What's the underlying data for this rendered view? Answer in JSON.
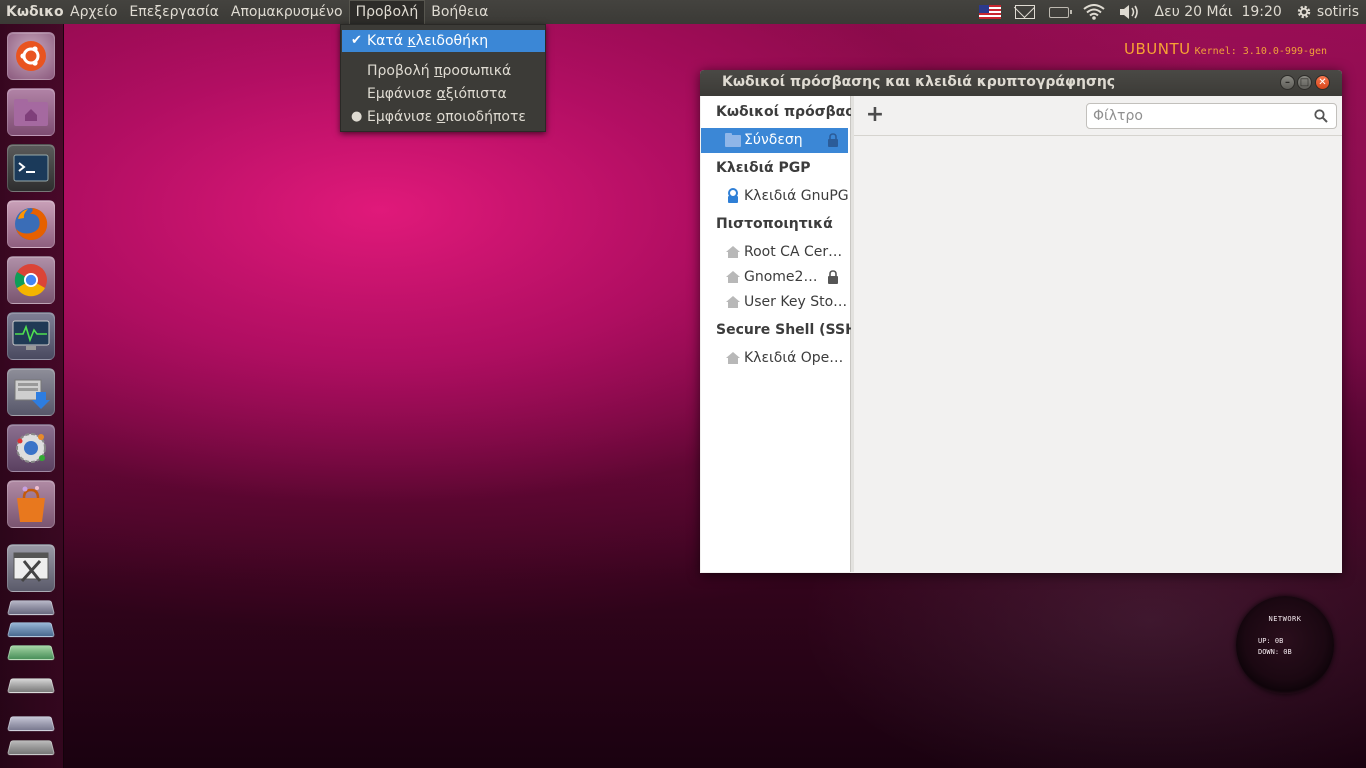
{
  "top_panel": {
    "app_name": "Κωδικοί",
    "menus": [
      "Αρχείο",
      "Επεξεργασία",
      "Απομακρυσμένο",
      "Προβολή",
      "Βοήθεια"
    ],
    "datetime": "Δευ 20 Μάι  19:20",
    "user": "sotiris"
  },
  "view_menu": {
    "by_keyring_pre": "Κατά ",
    "by_keyring_u": "κ",
    "by_keyring_post": "λειδοθήκη",
    "personal_pre": "Προβολή ",
    "personal_u": "π",
    "personal_post": "ροσωπικά",
    "trusted_pre": "Εμφάνισε ",
    "trusted_u": "α",
    "trusted_post": "ξιόπιστα",
    "any_pre": "Εμφάνισε ",
    "any_u": "ο",
    "any_post": "ποιοδήποτε"
  },
  "branding": {
    "name": "UBUNTU",
    "kernel": "Kernel: 3.10.0-999-gen"
  },
  "network_widget": {
    "title": "NETWORK",
    "up": "UP:   0B",
    "down": "DOWN: 0B"
  },
  "window": {
    "title": "Κωδικοί πρόσβασης και κλειδιά κρυπτογράφησης",
    "filter_placeholder": "Φίλτρο",
    "sidebar": {
      "passwords_heading": "Κωδικοί πρόσβαση",
      "login": "Σύνδεση",
      "pgp_heading": "Κλειδιά PGP",
      "gnupg": "Κλειδιά GnuPG",
      "certs_heading": "Πιστοποιητικά",
      "root_ca": "Root CA Cer…",
      "gnome2": "Gnome2…",
      "user_key": "User Key Sto…",
      "ssh_heading": "Secure Shell (SSH)",
      "openssh": "Κλειδιά Ope…"
    }
  },
  "colors": {
    "selection": "#3b87d6",
    "panel": "#3c3b37",
    "branding": "#f7a233"
  },
  "icons": [
    "ubuntu-logo-icon",
    "home-folder-icon",
    "terminal-icon",
    "firefox-icon",
    "chrome-icon",
    "system-monitor-icon",
    "installer-icon",
    "settings-icon",
    "software-center-icon"
  ]
}
